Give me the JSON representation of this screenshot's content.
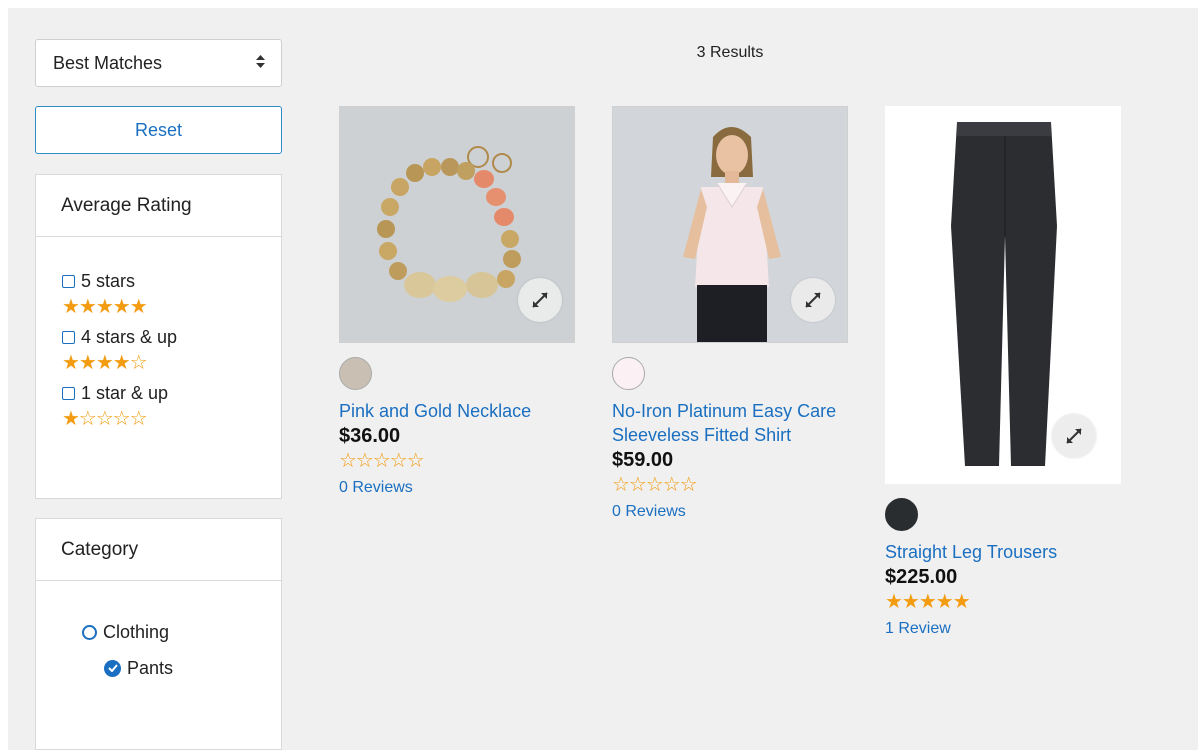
{
  "sort": {
    "selected": "Best Matches"
  },
  "reset_label": "Reset",
  "rating_filter": {
    "title": "Average Rating",
    "options": [
      {
        "label": "5 stars",
        "stars": "★★★★★"
      },
      {
        "label": "4 stars & up",
        "stars": "★★★★☆"
      },
      {
        "label": "1 star & up",
        "stars": "★☆☆☆☆"
      }
    ]
  },
  "category_filter": {
    "title": "Category",
    "items": [
      {
        "label": "Clothing",
        "checked": false
      },
      {
        "label": "Pants",
        "checked": true
      }
    ]
  },
  "results": {
    "count_label": "3 Results",
    "products": [
      {
        "name": "Pink and Gold Necklace",
        "price": "$36.00",
        "stars": "☆☆☆☆☆",
        "rating": 0,
        "reviews": "0 Reviews",
        "swatch_color": "#c9bfb2"
      },
      {
        "name": "No-Iron Platinum Easy Care Sleeveless Fitted Shirt",
        "price": "$59.00",
        "stars": "☆☆☆☆☆",
        "rating": 0,
        "reviews": "0 Reviews",
        "swatch_color": "#fbf0f3"
      },
      {
        "name": "Straight Leg Trousers",
        "price": "$225.00",
        "stars": "★★★★★",
        "rating": 5,
        "reviews": "1 Review",
        "swatch_color": "#2a2d30"
      }
    ]
  },
  "colors": {
    "accent": "#1a6fc1",
    "star": "#f39c12",
    "background": "#f0f0f0"
  }
}
